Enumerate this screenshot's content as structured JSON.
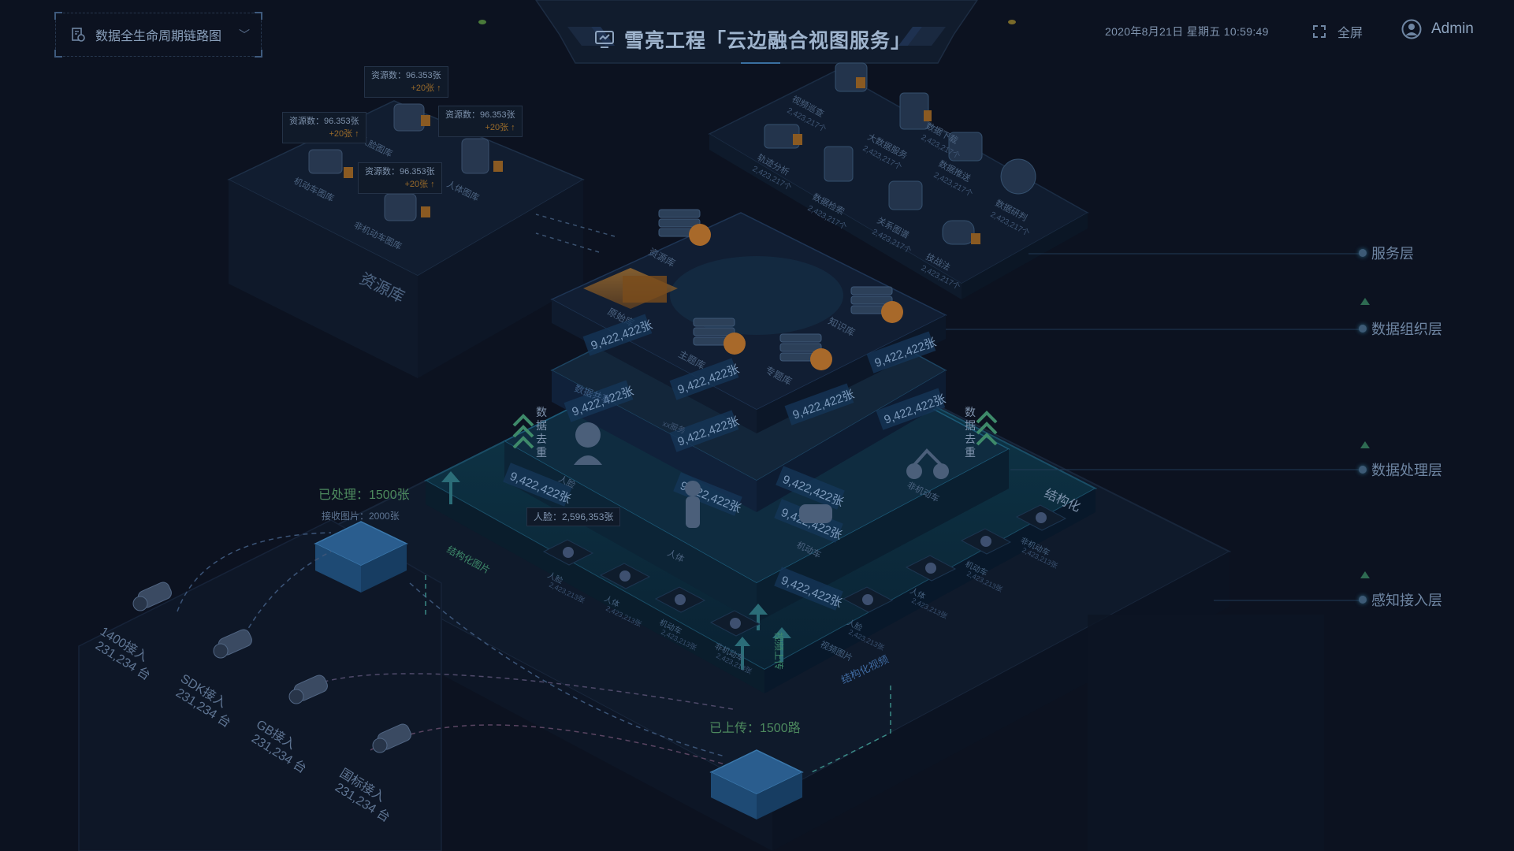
{
  "header": {
    "dropdown_label": "数据全生命周期链路图",
    "title": "雪亮工程「云边融合视图服务」",
    "datetime": "2020年8月21日 星期五 10:59:49",
    "fullscreen_label": "全屏",
    "user_name": "Admin"
  },
  "layers": {
    "service": "服务层",
    "organization": "数据组织层",
    "processing": "数据处理层",
    "access": "感知接入层"
  },
  "resource_library": {
    "label": "资源库",
    "items": [
      "机动车图库",
      "人脸图库",
      "人体图库",
      "非机动车图库"
    ],
    "tip_count": "资源数：96.353张",
    "tip_increase": "+20张 ↑"
  },
  "services": {
    "count_text": "2,423,217个",
    "items": [
      "视频巡查",
      "轨迹分析",
      "数据检索",
      "大数据服务",
      "关系图谱",
      "数据下载",
      "数据推送",
      "数据研判",
      "技战法"
    ]
  },
  "organization": {
    "items": [
      "资源库",
      "原始库",
      "主题库",
      "专题库",
      "知识库"
    ]
  },
  "processing": {
    "stat_value": "9,422,422张",
    "labels": [
      "人脸",
      "人体",
      "机动车",
      "非机动车"
    ],
    "dedupe_label": "数据去重",
    "structured_label": "结构化",
    "mini_labels": [
      "数据共享",
      "xx服务",
      "结构化图片",
      "数据去重"
    ]
  },
  "edge": {
    "processed": "已处理：1500张",
    "received": "接收图片：2000张",
    "face_tip": "人脸：2,596,353张",
    "uploaded": "已上传：1500路",
    "upload_label": "视频上传",
    "structured_video": "结构化视频",
    "card_labels": [
      "人脸",
      "人体",
      "机动车",
      "非机动车",
      "视频图片"
    ],
    "card_count": "2,423,213张"
  },
  "cameras": [
    {
      "type": "1400接入",
      "count": "231,234 台"
    },
    {
      "type": "SDK接入",
      "count": "231,234 台"
    },
    {
      "type": "GB接入",
      "count": "231,234 台"
    },
    {
      "type": "国标接入",
      "count": "231,234 台"
    }
  ],
  "colors": {
    "background": "#0c1220",
    "accent_teal": "#1fa3b0",
    "accent_blue": "#2a6fa8",
    "accent_orange": "#c9782a",
    "accent_green": "#3e8a6a"
  }
}
